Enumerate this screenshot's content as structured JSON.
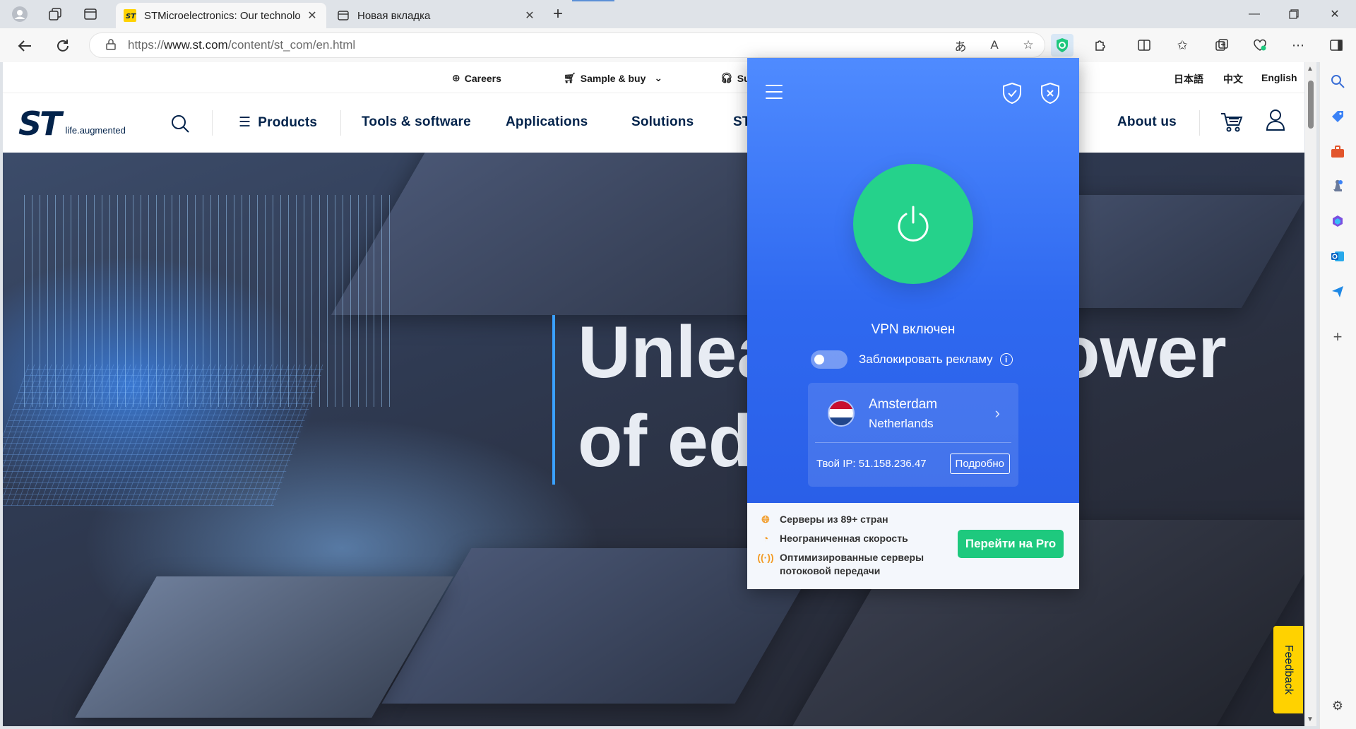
{
  "browser": {
    "tabs": [
      {
        "title": "STMicroelectronics: Our technolo",
        "active": true
      },
      {
        "title": "Новая вкладка",
        "active": false
      }
    ],
    "url_prefix": "https://",
    "url_host": "www.st.com",
    "url_path": "/content/st_com/en.html"
  },
  "site": {
    "top_links": {
      "careers": "Careers",
      "sample_buy": "Sample & buy",
      "support": "Su",
      "lang_ja": "日本語",
      "lang_zh": "中文",
      "lang_en": "English"
    },
    "logo_tagline": "life.augmented",
    "nav": {
      "products": "Products",
      "tools": "Tools & software",
      "applications": "Applications",
      "solutions": "Solutions",
      "st": "ST",
      "about": "About us"
    },
    "hero": {
      "line1_left": "Unlea",
      "line1_right": "ower",
      "line2_left": "of ed"
    },
    "feedback": "Feedback"
  },
  "vpn": {
    "status": "VPN включен",
    "ad_block_label": "Заблокировать рекламу",
    "ad_block_on": false,
    "location": {
      "city": "Amsterdam",
      "country": "Netherlands"
    },
    "ip_label": "Твой IP: 51.158.236.47",
    "details_button": "Подробно",
    "features": [
      "Серверы из 89+ стран",
      "Неограниченная скорость",
      "Оптимизированные серверы потоковой передачи"
    ],
    "pro_button": "Перейти на Pro",
    "colors": {
      "primary": "#2f69f0",
      "power": "#25d28b",
      "pro": "#1ec97e"
    }
  }
}
